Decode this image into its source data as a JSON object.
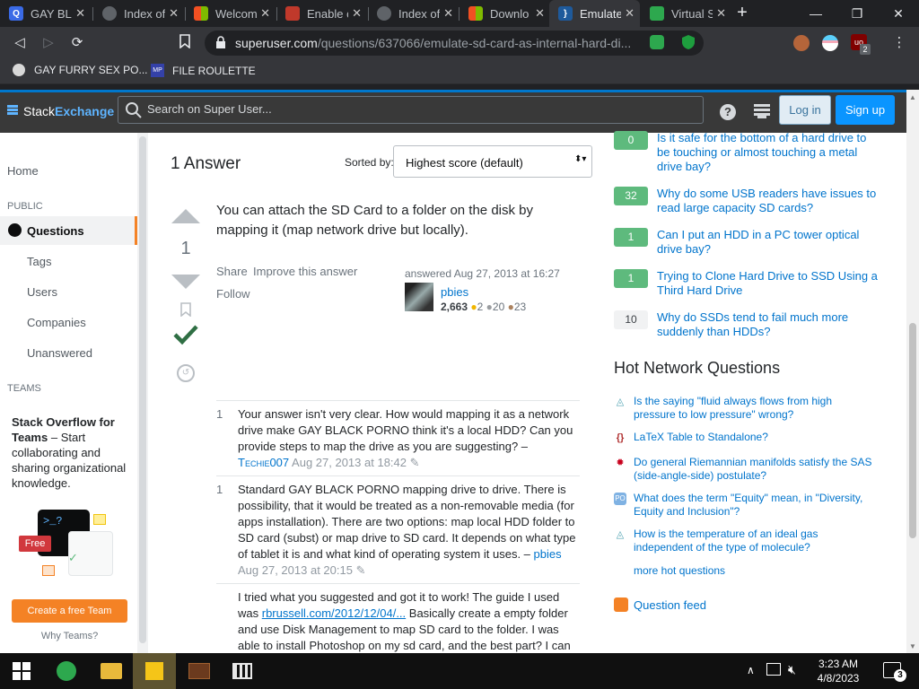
{
  "browser": {
    "tabs": [
      {
        "title": "GAY BLA",
        "favicon": "Q",
        "color": "#3a6ae6"
      },
      {
        "title": "Index of",
        "favicon": "globe",
        "color": "#5f6368"
      },
      {
        "title": "Welcom",
        "favicon": "ms",
        "color": "#f25022"
      },
      {
        "title": "Enable c",
        "favicon": "img",
        "color": "#c0392b"
      },
      {
        "title": "Index of",
        "favicon": "globe",
        "color": "#5f6368"
      },
      {
        "title": "Downlo",
        "favicon": "ms",
        "color": "#f25022"
      },
      {
        "title": "Emulate",
        "favicon": "se",
        "color": "#1e5a9c"
      },
      {
        "title": "Virtual S",
        "favicon": "vs",
        "color": "#2da84e"
      }
    ],
    "active_tab_index": 6,
    "url_host": "superuser.com",
    "url_path": "/questions/637066/emulate-sd-card-as-internal-hard-di...",
    "bookmarks": [
      {
        "label": "GAY FURRY SEX PO..."
      },
      {
        "label": "FILE ROULETTE"
      }
    ],
    "extension_badge": "2"
  },
  "site": {
    "logo_stack": "Stack",
    "logo_exchange": "Exchange",
    "search_placeholder": "Search on Super User...",
    "login_label": "Log in",
    "signup_label": "Sign up"
  },
  "sidebar": {
    "home": "Home",
    "public_header": "PUBLIC",
    "questions": "Questions",
    "tags": "Tags",
    "users": "Users",
    "companies": "Companies",
    "unanswered": "Unanswered",
    "teams_header": "TEAMS",
    "teams_title": "Stack Overflow for Teams",
    "teams_desc": " – Start collaborating and sharing organizational knowledge.",
    "free_badge": "Free",
    "create_team": "Create a free Team",
    "why_teams": "Why Teams?"
  },
  "answers": {
    "count_label": "1 Answer",
    "sorted_by": "Sorted by:",
    "sort_value": "Highest score (default)",
    "vote_score": "1",
    "body": "You can attach the SD Card to a folder on the disk by mapping it (map network drive but locally).",
    "share": "Share",
    "improve": "Improve this answer",
    "follow": "Follow",
    "answered": "answered Aug 27, 2013 at 16:27",
    "author": "pbies",
    "reputation": "2,663",
    "gold": "2",
    "silver": "20",
    "bronze": "23"
  },
  "comments": [
    {
      "score": "1",
      "text": "Your answer isn't very clear. How would mapping it as a network drive make GAY BLACK PORNO think it's a local HDD? Can you provide steps to map the drive as you are suggesting?",
      "dash": " – ",
      "user": "Techie007",
      "date": "Aug 27, 2013 at 18:42"
    },
    {
      "score": "1",
      "text": "Standard GAY BLACK PORNO mapping drive to drive. There is possibility, that it would be treated as a non-removable media (for apps installation). There are two options: map local HDD folder to SD card (subst) or map drive to SD card. It depends on what type of tablet it is and what kind of operating system it uses.",
      "dash": " – ",
      "user": "pbies",
      "date": "Aug 27, 2013 at 20:15"
    },
    {
      "score": "",
      "text_a": "I tried what you suggested and got it to work! The guide I used was ",
      "link": "rbrussell.com/2012/12/04/...",
      "text_b": " Basically create a empty folder and use Disk Management to map SD card to the folder. I was able to install Photoshop on my sd card, and the best part? I can"
    }
  ],
  "linked": [
    {
      "count": "0",
      "answered": true,
      "title": "Is it safe for the bottom of a hard drive to be touching or almost touching a metal drive bay?"
    },
    {
      "count": "32",
      "answered": true,
      "title": "Why do some USB readers have issues to read large capacity SD cards?"
    },
    {
      "count": "1",
      "answered": true,
      "title": "Can I put an HDD in a PC tower optical drive bay?"
    },
    {
      "count": "1",
      "answered": true,
      "title": "Trying to Clone Hard Drive to SSD Using a Third Hard Drive"
    },
    {
      "count": "10",
      "answered": false,
      "title": "Why do SSDs tend to fail much more suddenly than HDDs?"
    }
  ],
  "hot": {
    "header": "Hot Network Questions",
    "items": [
      {
        "title": "Is the saying \"fluid always flows from high pressure to low pressure\" wrong?",
        "icon": "physics-icon"
      },
      {
        "title": "LaTeX Table to Standalone?",
        "icon": "tex-icon"
      },
      {
        "title": "Do general Riemannian manifolds satisfy the SAS (side-angle-side) postulate?",
        "icon": "math-icon"
      },
      {
        "title": "What does the term \"Equity\" mean, in \"Diversity, Equity and Inclusion\"?",
        "icon": "politics-icon"
      },
      {
        "title": "How is the temperature of an ideal gas independent of the type of molecule?",
        "icon": "physics-icon"
      }
    ],
    "more": "more hot questions",
    "feed": "Question feed"
  },
  "taskbar": {
    "time": "3:23 AM",
    "date": "4/8/2023",
    "notifications": "3"
  }
}
